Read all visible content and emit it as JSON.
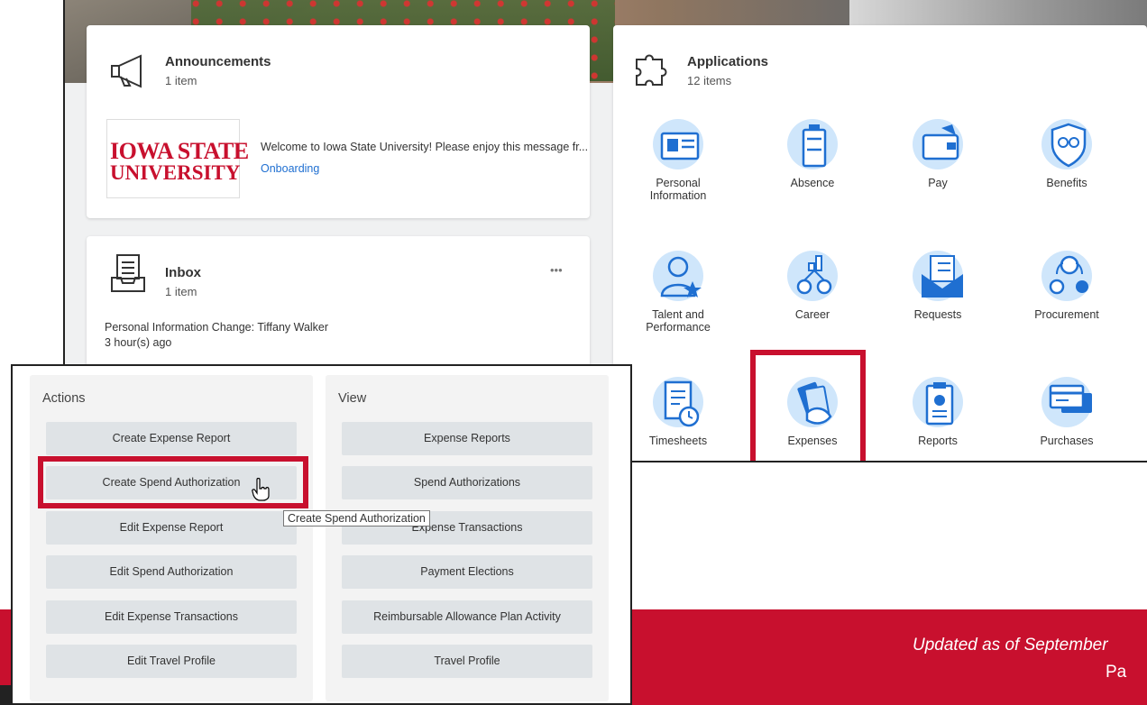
{
  "footer": {
    "updated_text": "Updated as of September",
    "page_text": "Pa"
  },
  "announcements": {
    "title": "Announcements",
    "count": "1 item",
    "logo_line1": "IOWA STATE",
    "logo_line2": "UNIVERSITY",
    "message": "Welcome to Iowa State University! Please enjoy this message fr...",
    "link": "Onboarding"
  },
  "inbox": {
    "title": "Inbox",
    "count": "1 item",
    "more": "•••",
    "item_title": "Personal Information Change: Tiffany Walker",
    "item_time": "3 hour(s) ago"
  },
  "applications": {
    "title": "Applications",
    "count": "12 items",
    "items": [
      {
        "label": "Personal Information",
        "icon": "id-card-icon"
      },
      {
        "label": "Absence",
        "icon": "suitcase-icon"
      },
      {
        "label": "Pay",
        "icon": "wallet-icon"
      },
      {
        "label": "Benefits",
        "icon": "shield-icon"
      },
      {
        "label": "Talent and Performance",
        "icon": "person-star-icon"
      },
      {
        "label": "Career",
        "icon": "career-chart-icon"
      },
      {
        "label": "Requests",
        "icon": "envelope-list-icon"
      },
      {
        "label": "Procurement",
        "icon": "procurement-icon"
      },
      {
        "label": "Timesheets",
        "icon": "timesheet-clock-icon"
      },
      {
        "label": "Expenses",
        "icon": "money-hand-icon"
      },
      {
        "label": "Reports",
        "icon": "clipboard-chart-icon"
      },
      {
        "label": "Purchases",
        "icon": "credit-card-icon"
      }
    ]
  },
  "actions": {
    "title": "Actions",
    "buttons": [
      "Create Expense Report",
      "Create Spend Authorization",
      "Edit Expense Report",
      "Edit Spend Authorization",
      "Edit Expense Transactions",
      "Edit Travel Profile"
    ]
  },
  "view": {
    "title": "View",
    "buttons": [
      "Expense Reports",
      "Spend Authorizations",
      "Expense Transactions",
      "Payment Elections",
      "Reimbursable Allowance Plan Activity",
      "Travel Profile"
    ]
  },
  "tooltip": "Create Spend Authorization",
  "colors": {
    "brand_red": "#c8102e",
    "icon_blue": "#1f6fd1",
    "icon_bg": "#cfe6fb",
    "button_bg": "#dfe3e6"
  }
}
